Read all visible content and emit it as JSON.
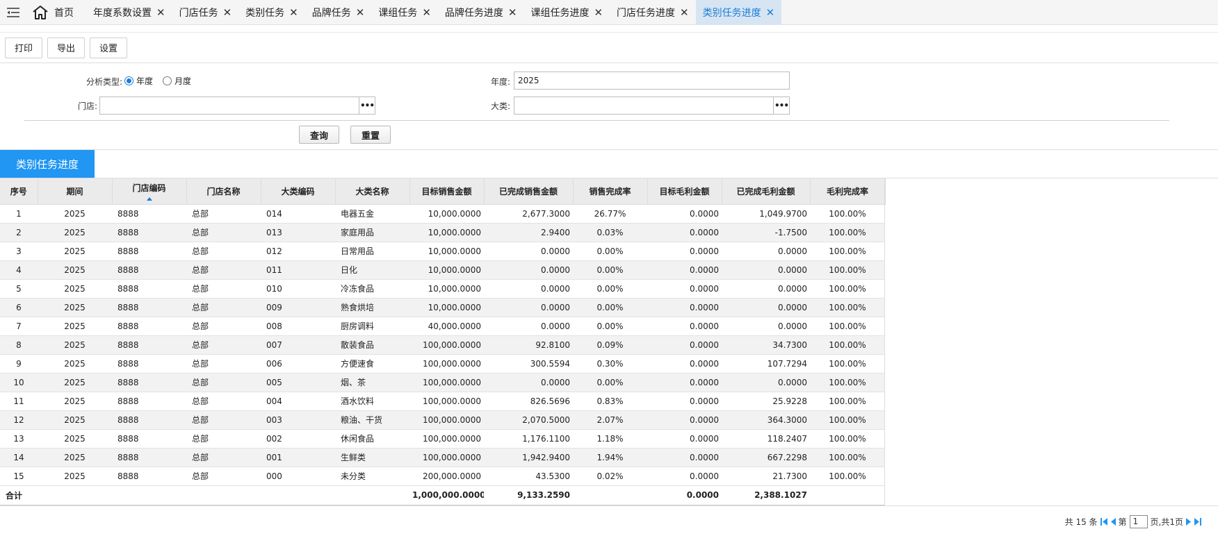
{
  "tabs": [
    {
      "label": "首页",
      "home": true,
      "closable": false,
      "active": false
    },
    {
      "label": "年度系数设置",
      "closable": true,
      "active": false
    },
    {
      "label": "门店任务",
      "closable": true,
      "active": false
    },
    {
      "label": "类别任务",
      "closable": true,
      "active": false
    },
    {
      "label": "品牌任务",
      "closable": true,
      "active": false
    },
    {
      "label": "课组任务",
      "closable": true,
      "active": false
    },
    {
      "label": "品牌任务进度",
      "closable": true,
      "active": false
    },
    {
      "label": "课组任务进度",
      "closable": true,
      "active": false
    },
    {
      "label": "门店任务进度",
      "closable": true,
      "active": false
    },
    {
      "label": "类别任务进度",
      "closable": true,
      "active": true
    }
  ],
  "toolbar": {
    "print": "打印",
    "export": "导出",
    "settings": "设置"
  },
  "filters": {
    "analysis_type_label": "分析类型:",
    "analysis_options": [
      "年度",
      "月度"
    ],
    "analysis_selected": "年度",
    "year_label": "年度:",
    "year_value": "2025",
    "store_label": "门店:",
    "store_value": "",
    "category_label": "大类:",
    "category_value": "",
    "query": "查询",
    "reset": "重置"
  },
  "panel_title": "类别任务进度",
  "grid": {
    "columns": [
      "序号",
      "期间",
      "门店编码",
      "门店名称",
      "大类编码",
      "大类名称",
      "目标销售金额",
      "已完成销售金额",
      "销售完成率",
      "目标毛利金额",
      "已完成毛利金额",
      "毛利完成率"
    ],
    "sorted_column": "门店编码",
    "rows": [
      [
        "1",
        "2025",
        "8888",
        "总部",
        "014",
        "电器五金",
        "10,000.0000",
        "2,677.3000",
        "26.77%",
        "0.0000",
        "1,049.9700",
        "100.00%"
      ],
      [
        "2",
        "2025",
        "8888",
        "总部",
        "013",
        "家庭用品",
        "10,000.0000",
        "2.9400",
        "0.03%",
        "0.0000",
        "-1.7500",
        "100.00%"
      ],
      [
        "3",
        "2025",
        "8888",
        "总部",
        "012",
        "日常用品",
        "10,000.0000",
        "0.0000",
        "0.00%",
        "0.0000",
        "0.0000",
        "100.00%"
      ],
      [
        "4",
        "2025",
        "8888",
        "总部",
        "011",
        "日化",
        "10,000.0000",
        "0.0000",
        "0.00%",
        "0.0000",
        "0.0000",
        "100.00%"
      ],
      [
        "5",
        "2025",
        "8888",
        "总部",
        "010",
        "冷冻食品",
        "10,000.0000",
        "0.0000",
        "0.00%",
        "0.0000",
        "0.0000",
        "100.00%"
      ],
      [
        "6",
        "2025",
        "8888",
        "总部",
        "009",
        "熟食烘培",
        "10,000.0000",
        "0.0000",
        "0.00%",
        "0.0000",
        "0.0000",
        "100.00%"
      ],
      [
        "7",
        "2025",
        "8888",
        "总部",
        "008",
        "厨房调料",
        "40,000.0000",
        "0.0000",
        "0.00%",
        "0.0000",
        "0.0000",
        "100.00%"
      ],
      [
        "8",
        "2025",
        "8888",
        "总部",
        "007",
        "散装食品",
        "100,000.0000",
        "92.8100",
        "0.09%",
        "0.0000",
        "34.7300",
        "100.00%"
      ],
      [
        "9",
        "2025",
        "8888",
        "总部",
        "006",
        "方便速食",
        "100,000.0000",
        "300.5594",
        "0.30%",
        "0.0000",
        "107.7294",
        "100.00%"
      ],
      [
        "10",
        "2025",
        "8888",
        "总部",
        "005",
        "烟、茶",
        "100,000.0000",
        "0.0000",
        "0.00%",
        "0.0000",
        "0.0000",
        "100.00%"
      ],
      [
        "11",
        "2025",
        "8888",
        "总部",
        "004",
        "酒水饮料",
        "100,000.0000",
        "826.5696",
        "0.83%",
        "0.0000",
        "25.9228",
        "100.00%"
      ],
      [
        "12",
        "2025",
        "8888",
        "总部",
        "003",
        "粮油、干货",
        "100,000.0000",
        "2,070.5000",
        "2.07%",
        "0.0000",
        "364.3000",
        "100.00%"
      ],
      [
        "13",
        "2025",
        "8888",
        "总部",
        "002",
        "休闲食品",
        "100,000.0000",
        "1,176.1100",
        "1.18%",
        "0.0000",
        "118.2407",
        "100.00%"
      ],
      [
        "14",
        "2025",
        "8888",
        "总部",
        "001",
        "生鲜类",
        "100,000.0000",
        "1,942.9400",
        "1.94%",
        "0.0000",
        "667.2298",
        "100.00%"
      ],
      [
        "15",
        "2025",
        "8888",
        "总部",
        "000",
        "未分类",
        "200,000.0000",
        "43.5300",
        "0.02%",
        "0.0000",
        "21.7300",
        "100.00%"
      ]
    ],
    "total": {
      "label": "合计",
      "target_sales": "1,000,000.0000",
      "done_sales": "9,133.2590",
      "target_profit": "0.0000",
      "done_profit": "2,388.1027"
    }
  },
  "pager": {
    "total_text": "共 15 条",
    "page_prefix": "第",
    "page_value": "1",
    "page_suffix": "页,共1页"
  },
  "colors": {
    "accent": "#2196f3",
    "active_tab_bg": "#d7e5f3",
    "active_tab_text": "#1a7dd6"
  }
}
